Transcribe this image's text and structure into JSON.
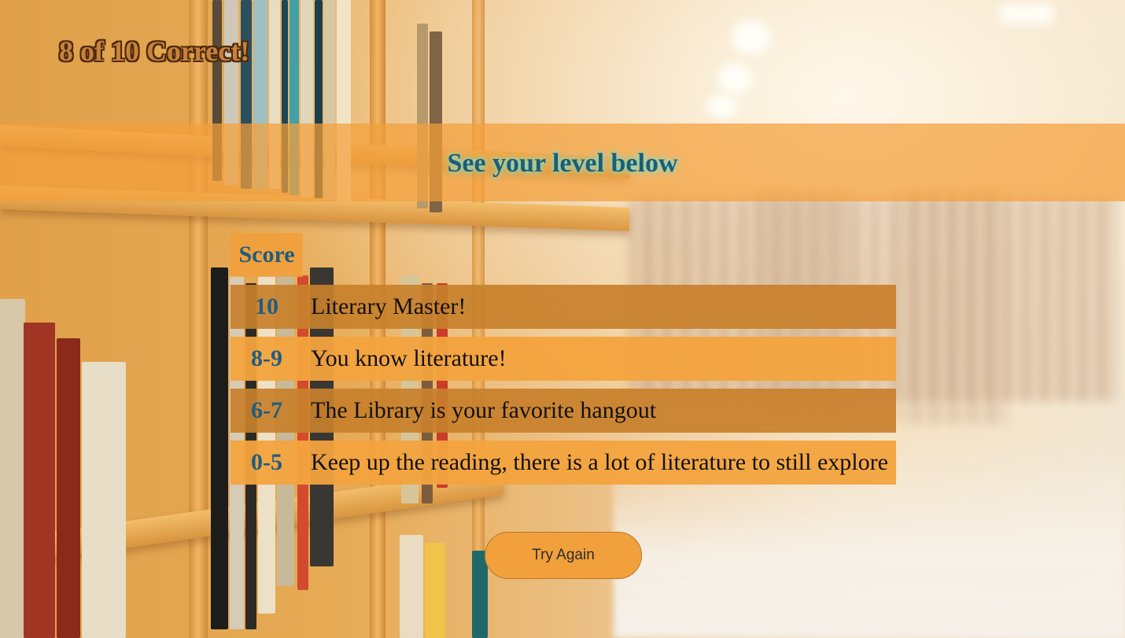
{
  "result": {
    "title": "8 of 10 Correct!"
  },
  "banner": {
    "text": "See your level below"
  },
  "score_table": {
    "header": "Score",
    "rows": [
      {
        "score": "10",
        "level": "Literary Master!"
      },
      {
        "score": "8-9",
        "level": "You know literature!"
      },
      {
        "score": "6-7",
        "level": "The Library is your favorite hangout"
      },
      {
        "score": "0-5",
        "level": "Keep up the reading, there is a lot of literature to still explore"
      }
    ]
  },
  "actions": {
    "try_again_label": "Try Again"
  },
  "colors": {
    "accent_orange": "#f2a03c",
    "row_dark": "#c8802b",
    "score_blue": "#1e5d7f",
    "banner_text": "#1e5d75",
    "banner_glow": "#7ee0c8",
    "title_outline": "#4b2a10"
  }
}
